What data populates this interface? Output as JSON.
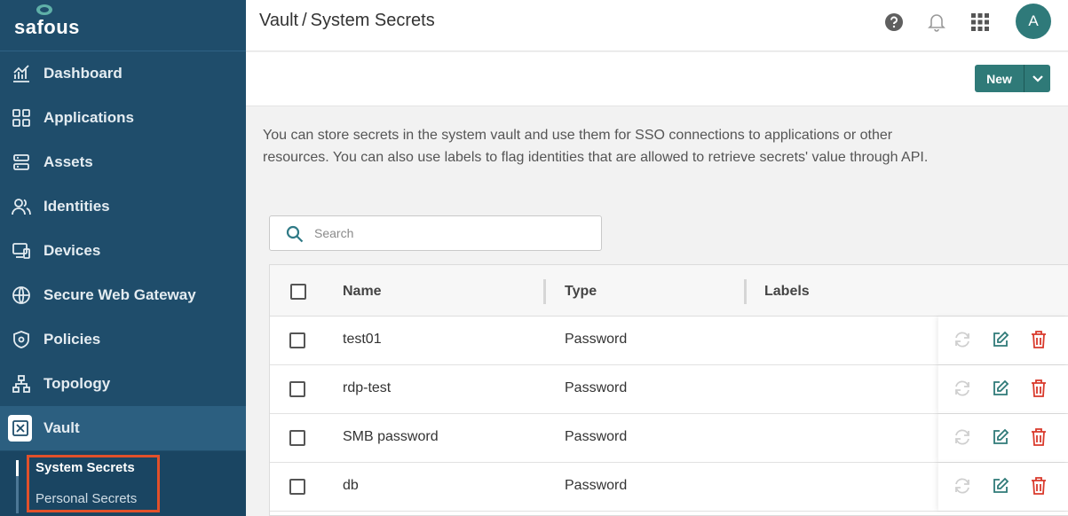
{
  "brand": {
    "name": "safous"
  },
  "sidebar": {
    "items": [
      {
        "label": "Dashboard",
        "icon": "dashboard-icon"
      },
      {
        "label": "Applications",
        "icon": "applications-grid-icon"
      },
      {
        "label": "Assets",
        "icon": "assets-server-icon"
      },
      {
        "label": "Identities",
        "icon": "identities-users-icon"
      },
      {
        "label": "Devices",
        "icon": "devices-icon"
      },
      {
        "label": "Secure Web Gateway",
        "icon": "globe-icon"
      },
      {
        "label": "Policies",
        "icon": "shield-icon"
      },
      {
        "label": "Topology",
        "icon": "topology-icon"
      },
      {
        "label": "Vault",
        "icon": "vault-icon",
        "active": true
      }
    ],
    "sub_items": [
      {
        "label": "System Secrets",
        "active": true
      },
      {
        "label": "Personal Secrets",
        "active": false
      }
    ]
  },
  "header": {
    "breadcrumb_parent": "Vault",
    "breadcrumb_separator": "/",
    "breadcrumb_current": "System Secrets",
    "avatar_initial": "A",
    "icons": [
      "help-icon",
      "bell-icon",
      "apps-grid-icon"
    ]
  },
  "toolbar": {
    "new_label": "New"
  },
  "description": "You can store secrets in the system vault and use them for SSO connections to applications or other resources. You can also use labels to flag identities that are allowed to retrieve secrets' value through API.",
  "search": {
    "placeholder": "Search",
    "value": ""
  },
  "table": {
    "columns": [
      "Name",
      "Type",
      "Labels"
    ],
    "rows": [
      {
        "name": "test01",
        "type": "Password",
        "labels": ""
      },
      {
        "name": "rdp-test",
        "type": "Password",
        "labels": ""
      },
      {
        "name": "SMB password",
        "type": "Password",
        "labels": ""
      },
      {
        "name": "db",
        "type": "Password",
        "labels": ""
      }
    ]
  },
  "colors": {
    "sidebar_bg": "#1f4d6b",
    "accent": "#2f7a78",
    "delete": "#d9392b",
    "highlight": "#e2502a"
  }
}
